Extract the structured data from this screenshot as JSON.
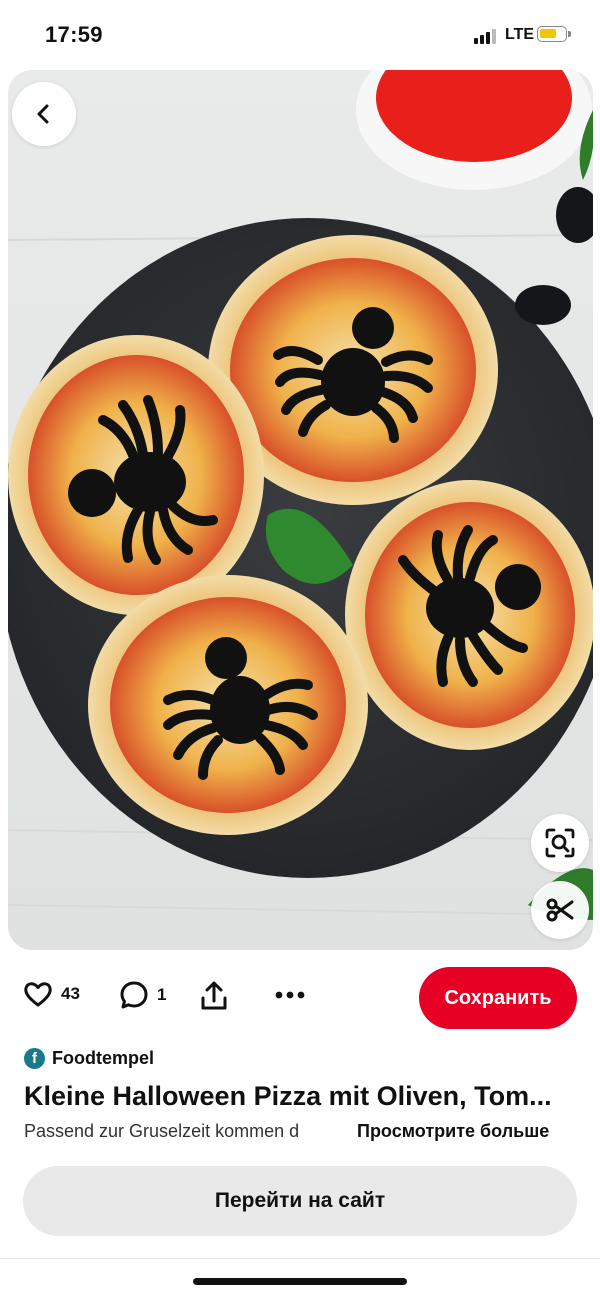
{
  "status_bar": {
    "time": "17:59",
    "network": "LTE"
  },
  "pin": {
    "likes": "43",
    "comments": "1",
    "save_label": "Сохранить",
    "source": "Foodtempel",
    "source_icon_letter": "f",
    "title": "Kleine Halloween Pizza mit Oliven, Tom...",
    "description": "Passend zur Gruselzeit kommen d",
    "see_more_label": "Просмотрите больше",
    "visit_label": "Перейти на сайт"
  },
  "icons": {
    "back": "chevron-left-icon",
    "like": "heart-icon",
    "comment": "speech-bubble-icon",
    "share": "share-icon",
    "more": "more-dots-icon",
    "lens": "visual-search-icon",
    "cutout": "scissors-icon"
  },
  "colors": {
    "accent": "#e60023",
    "visit_button_bg": "#e9e9e9",
    "battery": "#f5c400",
    "source_icon_bg": "#1a7a8a"
  }
}
